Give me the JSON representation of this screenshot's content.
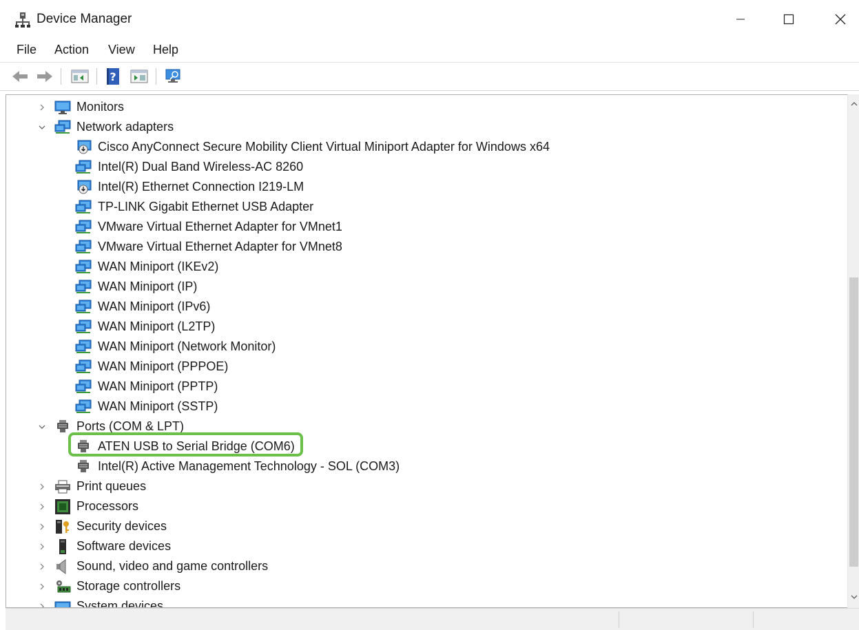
{
  "window": {
    "title": "Device Manager",
    "controls": {
      "minimize": "—",
      "maximize": "☐",
      "close": "✕"
    }
  },
  "menu": [
    "File",
    "Action",
    "View",
    "Help"
  ],
  "tree": [
    {
      "label": "Monitors",
      "icon": "monitor-icon",
      "expanded": false,
      "level": 0
    },
    {
      "label": "Network adapters",
      "icon": "network-adapter-icon",
      "expanded": true,
      "level": 0
    },
    {
      "label": "Cisco AnyConnect Secure Mobility Client Virtual Miniport Adapter for Windows x64",
      "icon": "network-adapter-warning-icon",
      "level": 1
    },
    {
      "label": "Intel(R) Dual Band Wireless-AC 8260",
      "icon": "network-adapter-icon",
      "level": 1
    },
    {
      "label": "Intel(R) Ethernet Connection I219-LM",
      "icon": "network-adapter-warning-icon",
      "level": 1
    },
    {
      "label": "TP-LINK Gigabit Ethernet USB Adapter",
      "icon": "network-adapter-icon",
      "level": 1
    },
    {
      "label": "VMware Virtual Ethernet Adapter for VMnet1",
      "icon": "network-adapter-icon",
      "level": 1
    },
    {
      "label": "VMware Virtual Ethernet Adapter for VMnet8",
      "icon": "network-adapter-icon",
      "level": 1
    },
    {
      "label": "WAN Miniport (IKEv2)",
      "icon": "network-adapter-icon",
      "level": 1
    },
    {
      "label": "WAN Miniport (IP)",
      "icon": "network-adapter-icon",
      "level": 1
    },
    {
      "label": "WAN Miniport (IPv6)",
      "icon": "network-adapter-icon",
      "level": 1
    },
    {
      "label": "WAN Miniport (L2TP)",
      "icon": "network-adapter-icon",
      "level": 1
    },
    {
      "label": "WAN Miniport (Network Monitor)",
      "icon": "network-adapter-icon",
      "level": 1
    },
    {
      "label": "WAN Miniport (PPPOE)",
      "icon": "network-adapter-icon",
      "level": 1
    },
    {
      "label": "WAN Miniport (PPTP)",
      "icon": "network-adapter-icon",
      "level": 1
    },
    {
      "label": "WAN Miniport (SSTP)",
      "icon": "network-adapter-icon",
      "level": 1
    },
    {
      "label": "Ports (COM & LPT)",
      "icon": "port-icon",
      "expanded": true,
      "level": 0
    },
    {
      "label": "ATEN USB to Serial Bridge (COM6)",
      "icon": "port-icon",
      "level": 1,
      "highlighted": true
    },
    {
      "label": "Intel(R) Active Management Technology - SOL (COM3)",
      "icon": "port-icon",
      "level": 1
    },
    {
      "label": "Print queues",
      "icon": "printer-icon",
      "expanded": false,
      "level": 0
    },
    {
      "label": "Processors",
      "icon": "processor-icon",
      "expanded": false,
      "level": 0
    },
    {
      "label": "Security devices",
      "icon": "security-device-icon",
      "expanded": false,
      "level": 0
    },
    {
      "label": "Software devices",
      "icon": "software-device-icon",
      "expanded": false,
      "level": 0
    },
    {
      "label": "Sound, video and game controllers",
      "icon": "speaker-icon",
      "expanded": false,
      "level": 0
    },
    {
      "label": "Storage controllers",
      "icon": "storage-controller-icon",
      "expanded": false,
      "level": 0
    },
    {
      "label": "System devices",
      "icon": "system-device-icon",
      "expanded": false,
      "level": 0
    }
  ],
  "colors": {
    "highlight": "#6cc04a",
    "accent": "#1e78d7"
  }
}
